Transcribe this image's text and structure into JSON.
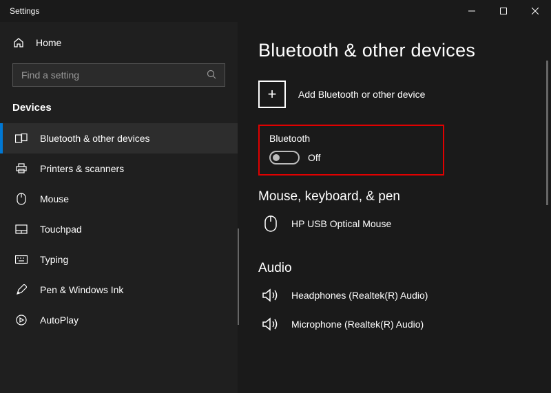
{
  "window": {
    "title": "Settings"
  },
  "sidebar": {
    "home": "Home",
    "search_placeholder": "Find a setting",
    "section": "Devices",
    "items": [
      {
        "label": "Bluetooth & other devices"
      },
      {
        "label": "Printers & scanners"
      },
      {
        "label": "Mouse"
      },
      {
        "label": "Touchpad"
      },
      {
        "label": "Typing"
      },
      {
        "label": "Pen & Windows Ink"
      },
      {
        "label": "AutoPlay"
      }
    ]
  },
  "main": {
    "title": "Bluetooth & other devices",
    "add_label": "Add Bluetooth or other device",
    "bluetooth": {
      "heading": "Bluetooth",
      "state": "Off"
    },
    "mouse_group": {
      "heading": "Mouse, keyboard, & pen",
      "device": "HP USB Optical Mouse"
    },
    "audio_group": {
      "heading": "Audio",
      "headphones": "Headphones (Realtek(R) Audio)",
      "microphone": "Microphone (Realtek(R) Audio)"
    }
  }
}
